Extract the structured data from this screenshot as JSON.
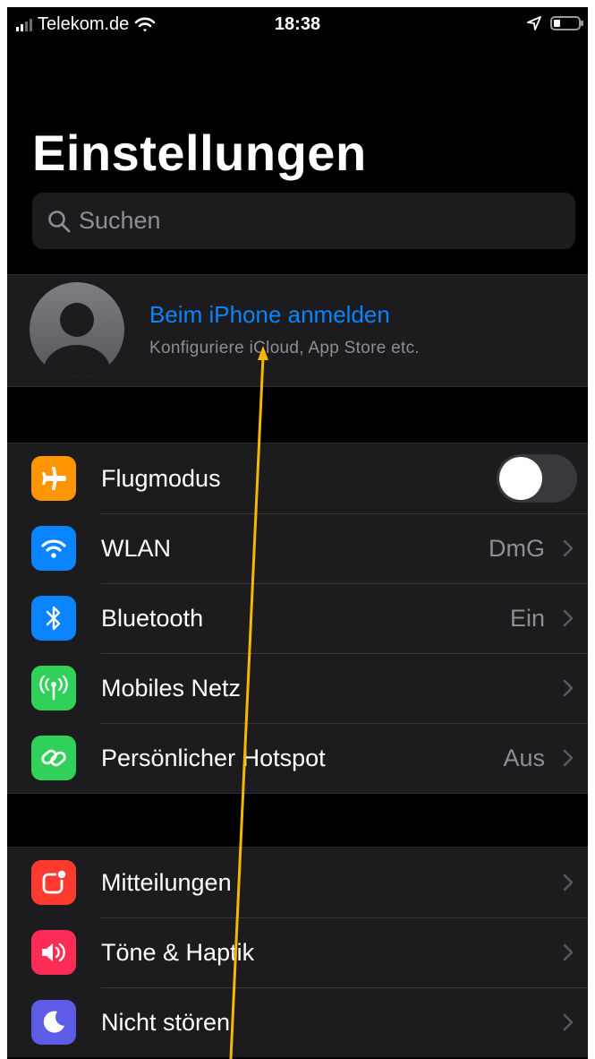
{
  "status_bar": {
    "carrier": "Telekom.de",
    "time": "18:38"
  },
  "page": {
    "title": "Einstellungen"
  },
  "search": {
    "placeholder": "Suchen"
  },
  "account": {
    "title": "Beim iPhone anmelden",
    "subtitle": "Konfiguriere iCloud, App Store etc."
  },
  "connectivity": {
    "airplane": {
      "label": "Flugmodus",
      "icon": "airplane-icon",
      "color": "#ff9500",
      "toggle_on": false
    },
    "wlan": {
      "label": "WLAN",
      "value": "DmG",
      "icon": "wifi-icon",
      "color": "#0a84ff"
    },
    "bluetooth": {
      "label": "Bluetooth",
      "value": "Ein",
      "icon": "bluetooth-icon",
      "color": "#0a84ff"
    },
    "mobile": {
      "label": "Mobiles Netz",
      "value": "",
      "icon": "antenna-icon",
      "color": "#30d158"
    },
    "hotspot": {
      "label": "Persönlicher Hotspot",
      "value": "Aus",
      "icon": "hotspot-icon",
      "color": "#30d158"
    }
  },
  "notifications": {
    "mitteilungen": {
      "label": "Mitteilungen",
      "icon": "notifications-icon",
      "color": "#ff3b30"
    },
    "toene": {
      "label": "Töne & Haptik",
      "icon": "speaker-icon",
      "color": "#ff2d55"
    },
    "nicht_stoeren": {
      "label": "Nicht stören",
      "icon": "moon-icon",
      "color": "#5e5ce6"
    }
  },
  "colors": {
    "accent": "#0a84ff",
    "annotation_arrow": "#f5b800"
  }
}
